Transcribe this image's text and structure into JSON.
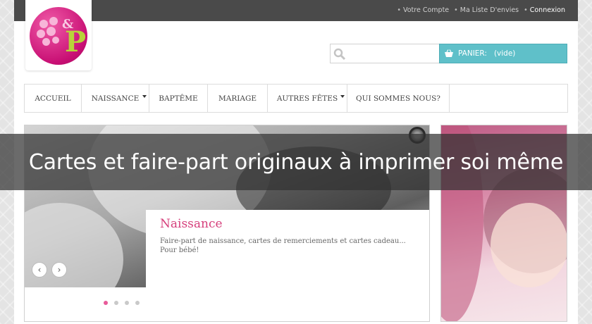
{
  "topbar": {
    "links": [
      "Votre Compte",
      "Ma Liste D'envies",
      "Connexion"
    ]
  },
  "logo": {
    "amp": "&",
    "letter": "P"
  },
  "search": {
    "value": "",
    "placeholder": ""
  },
  "cart": {
    "label": "PANIER:",
    "status": "(vide)"
  },
  "nav": {
    "items": [
      {
        "label": "ACCUEIL"
      },
      {
        "label": "NAISSANCE"
      },
      {
        "label": "BAPTÊME"
      },
      {
        "label": "MARIAGE"
      },
      {
        "label": "AUTRES FÊTES"
      },
      {
        "label": "QUI SOMMES NOUS?"
      }
    ]
  },
  "slider": {
    "title": "Naissance",
    "text_line1": "Faire-part de naissance, cartes de remerciements et cartes cadeau...",
    "text_line2": "Pour bébé!",
    "prev": "‹",
    "next": "›"
  },
  "overlay": {
    "title": "Cartes et faire-part originaux à imprimer soi même"
  },
  "colors": {
    "accent_pink": "#d6407c",
    "cart_teal": "#5fc0c9",
    "topbar": "#4a4a4a"
  }
}
